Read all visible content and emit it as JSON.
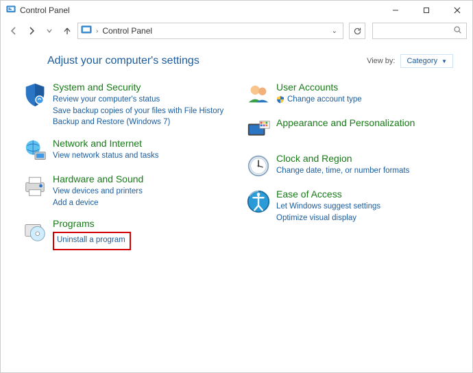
{
  "window": {
    "title": "Control Panel"
  },
  "address": {
    "crumb": "Control Panel"
  },
  "header": {
    "adjust": "Adjust your computer's settings",
    "view_by_label": "View by:",
    "view_by_value": "Category"
  },
  "cats": {
    "system": {
      "title": "System and Security",
      "l1": "Review your computer's status",
      "l2": "Save backup copies of your files with File History",
      "l3": "Backup and Restore (Windows 7)"
    },
    "network": {
      "title": "Network and Internet",
      "l1": "View network status and tasks"
    },
    "hardware": {
      "title": "Hardware and Sound",
      "l1": "View devices and printers",
      "l2": "Add a device"
    },
    "programs": {
      "title": "Programs",
      "l1": "Uninstall a program"
    },
    "users": {
      "title": "User Accounts",
      "l1": "Change account type"
    },
    "appearance": {
      "title": "Appearance and Personalization"
    },
    "clock": {
      "title": "Clock and Region",
      "l1": "Change date, time, or number formats"
    },
    "ease": {
      "title": "Ease of Access",
      "l1": "Let Windows suggest settings",
      "l2": "Optimize visual display"
    }
  }
}
